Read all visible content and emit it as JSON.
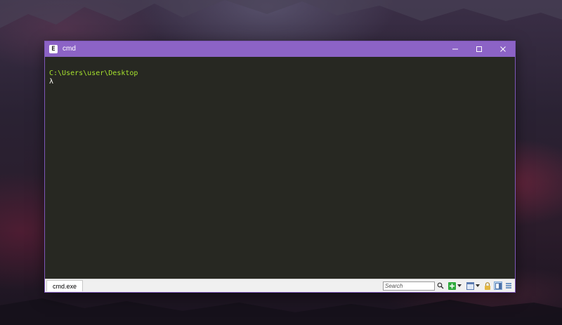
{
  "window": {
    "title": "cmd",
    "app_icon": "console-emulator-icon",
    "accent_color": "#8c63c6"
  },
  "controls": {
    "minimize_icon": "minimize-icon",
    "maximize_icon": "maximize-icon",
    "close_icon": "close-icon"
  },
  "console": {
    "path": "C:\\Users\\user\\Desktop",
    "prompt": "λ",
    "path_color": "#a6e22e",
    "background_color": "#272822"
  },
  "statusbar": {
    "tab_label": "cmd.exe",
    "search_placeholder": "Search",
    "tools": [
      "search-icon",
      "new-console-icon",
      "chevron-down-icon",
      "window-icon",
      "chevron-down-icon",
      "lock-icon",
      "split-view-icon",
      "menu-icon"
    ]
  }
}
